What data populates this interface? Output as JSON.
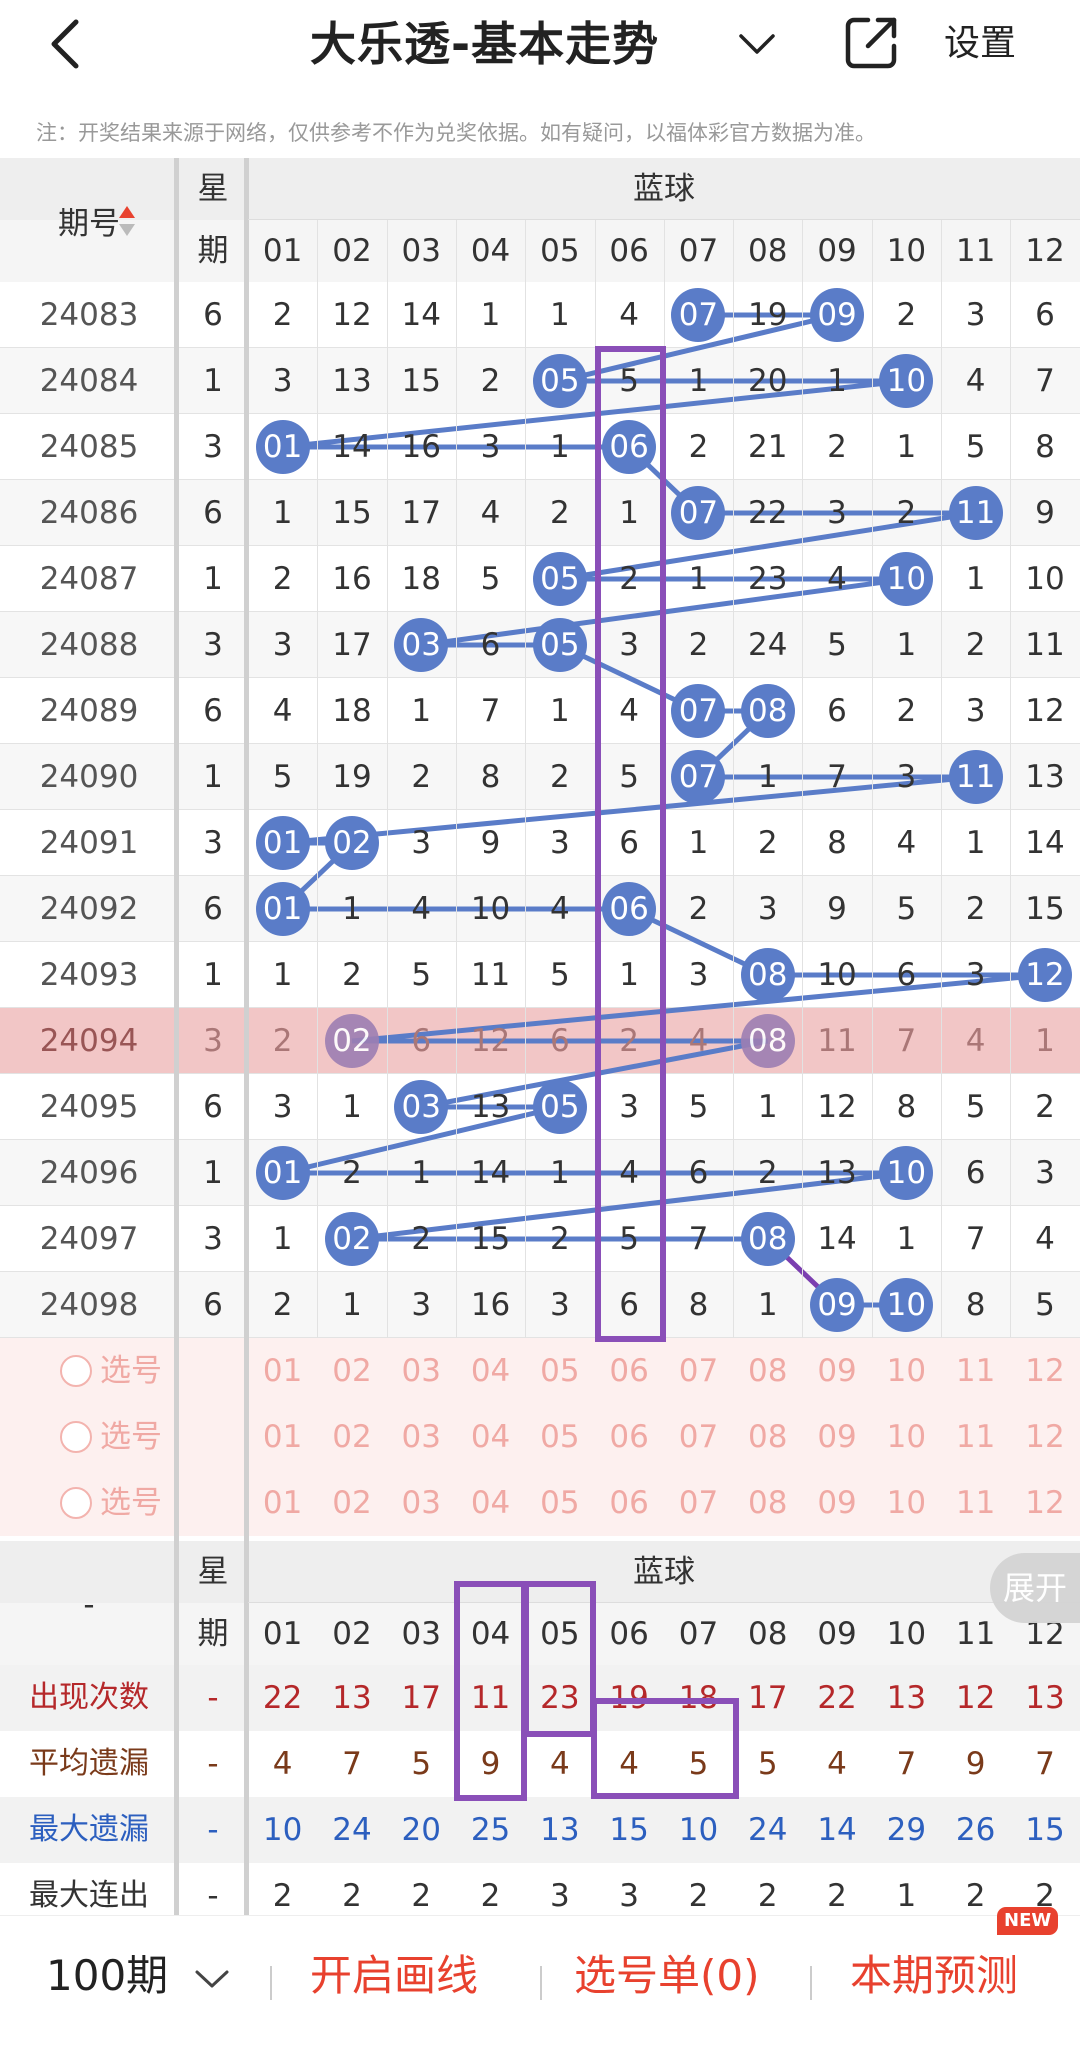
{
  "header": {
    "title": "大乐透-基本走势",
    "settings_label": "设置",
    "note": "注：开奖结果来源于网络，仅供参考不作为兑奖依据。如有疑问，以福体彩官方数据为准。"
  },
  "table": {
    "col_period": "期号",
    "col_week_1": "星",
    "col_week_2": "期",
    "group_label": "蓝球",
    "columns": [
      "01",
      "02",
      "03",
      "04",
      "05",
      "06",
      "07",
      "08",
      "09",
      "10",
      "11",
      "12"
    ],
    "rows": [
      {
        "period": "24083",
        "week": "6",
        "cells": [
          "2",
          "12",
          "14",
          "1",
          "1",
          "4",
          "07",
          "19",
          "09",
          "2",
          "3",
          "6"
        ],
        "hits": [
          6,
          8
        ]
      },
      {
        "period": "24084",
        "week": "1",
        "cells": [
          "3",
          "13",
          "15",
          "2",
          "05",
          "5",
          "1",
          "20",
          "1",
          "10",
          "4",
          "7"
        ],
        "hits": [
          4,
          9
        ]
      },
      {
        "period": "24085",
        "week": "3",
        "cells": [
          "01",
          "14",
          "16",
          "3",
          "1",
          "06",
          "2",
          "21",
          "2",
          "1",
          "5",
          "8"
        ],
        "hits": [
          0,
          5
        ]
      },
      {
        "period": "24086",
        "week": "6",
        "cells": [
          "1",
          "15",
          "17",
          "4",
          "2",
          "1",
          "07",
          "22",
          "3",
          "2",
          "11",
          "9"
        ],
        "hits": [
          6,
          10
        ]
      },
      {
        "period": "24087",
        "week": "1",
        "cells": [
          "2",
          "16",
          "18",
          "5",
          "05",
          "2",
          "1",
          "23",
          "4",
          "10",
          "1",
          "10"
        ],
        "hits": [
          4,
          9
        ]
      },
      {
        "period": "24088",
        "week": "3",
        "cells": [
          "3",
          "17",
          "03",
          "6",
          "05",
          "3",
          "2",
          "24",
          "5",
          "1",
          "2",
          "11"
        ],
        "hits": [
          2,
          4
        ]
      },
      {
        "period": "24089",
        "week": "6",
        "cells": [
          "4",
          "18",
          "1",
          "7",
          "1",
          "4",
          "07",
          "08",
          "6",
          "2",
          "3",
          "12"
        ],
        "hits": [
          6,
          7
        ]
      },
      {
        "period": "24090",
        "week": "1",
        "cells": [
          "5",
          "19",
          "2",
          "8",
          "2",
          "5",
          "07",
          "1",
          "7",
          "3",
          "11",
          "13"
        ],
        "hits": [
          6,
          10
        ]
      },
      {
        "period": "24091",
        "week": "3",
        "cells": [
          "01",
          "02",
          "3",
          "9",
          "3",
          "6",
          "1",
          "2",
          "8",
          "4",
          "1",
          "14"
        ],
        "hits": [
          0,
          1
        ]
      },
      {
        "period": "24092",
        "week": "6",
        "cells": [
          "01",
          "1",
          "4",
          "10",
          "4",
          "06",
          "2",
          "3",
          "9",
          "5",
          "2",
          "15"
        ],
        "hits": [
          0,
          5
        ]
      },
      {
        "period": "24093",
        "week": "1",
        "cells": [
          "1",
          "2",
          "5",
          "11",
          "5",
          "1",
          "3",
          "08",
          "10",
          "6",
          "3",
          "12"
        ],
        "hits": [
          7,
          11
        ]
      },
      {
        "period": "24094",
        "week": "3",
        "cells": [
          "2",
          "02",
          "6",
          "12",
          "6",
          "2",
          "4",
          "08",
          "11",
          "7",
          "4",
          "1"
        ],
        "hits": [
          1,
          7
        ],
        "highlight": true
      },
      {
        "period": "24095",
        "week": "6",
        "cells": [
          "3",
          "1",
          "03",
          "13",
          "05",
          "3",
          "5",
          "1",
          "12",
          "8",
          "5",
          "2"
        ],
        "hits": [
          2,
          4
        ]
      },
      {
        "period": "24096",
        "week": "1",
        "cells": [
          "01",
          "2",
          "1",
          "14",
          "1",
          "4",
          "6",
          "2",
          "13",
          "10",
          "6",
          "3"
        ],
        "hits": [
          0,
          9
        ]
      },
      {
        "period": "24097",
        "week": "3",
        "cells": [
          "1",
          "02",
          "2",
          "15",
          "2",
          "5",
          "7",
          "08",
          "14",
          "1",
          "7",
          "4"
        ],
        "hits": [
          1,
          7
        ]
      },
      {
        "period": "24098",
        "week": "6",
        "cells": [
          "2",
          "1",
          "3",
          "16",
          "3",
          "6",
          "8",
          "1",
          "09",
          "10",
          "8",
          "5"
        ],
        "hits": [
          8,
          9
        ]
      }
    ],
    "pick_rows": [
      {
        "label": "选号"
      },
      {
        "label": "选号"
      },
      {
        "label": "选号"
      }
    ],
    "stats_header_period": "-",
    "stats": [
      {
        "label": "出现次数",
        "week": "-",
        "values": [
          "22",
          "13",
          "17",
          "11",
          "23",
          "19",
          "18",
          "17",
          "22",
          "13",
          "12",
          "13"
        ],
        "color": "#b5282a"
      },
      {
        "label": "平均遗漏",
        "week": "-",
        "values": [
          "4",
          "7",
          "5",
          "9",
          "4",
          "4",
          "5",
          "5",
          "4",
          "7",
          "9",
          "7"
        ],
        "color": "#7a3a1a"
      },
      {
        "label": "最大遗漏",
        "week": "-",
        "values": [
          "10",
          "24",
          "20",
          "25",
          "13",
          "15",
          "10",
          "24",
          "14",
          "29",
          "26",
          "15"
        ],
        "color": "#2c5fbf"
      },
      {
        "label": "最大连出",
        "week": "-",
        "values": [
          "2",
          "2",
          "2",
          "2",
          "3",
          "3",
          "2",
          "2",
          "2",
          "1",
          "2",
          "2"
        ],
        "color": "#333333"
      }
    ],
    "expand_label": "展开"
  },
  "bottom_bar": {
    "periods_label": "100期",
    "draw_line_label": "开启画线",
    "pick_list_label": "选号单(0)",
    "predict_label": "本期预测",
    "new_badge": "NEW"
  },
  "colors": {
    "ball": "#5a7cc8",
    "accent_red": "#e8412e",
    "highlight_row": "#f3c4c4",
    "box": "#8a4fb8"
  }
}
